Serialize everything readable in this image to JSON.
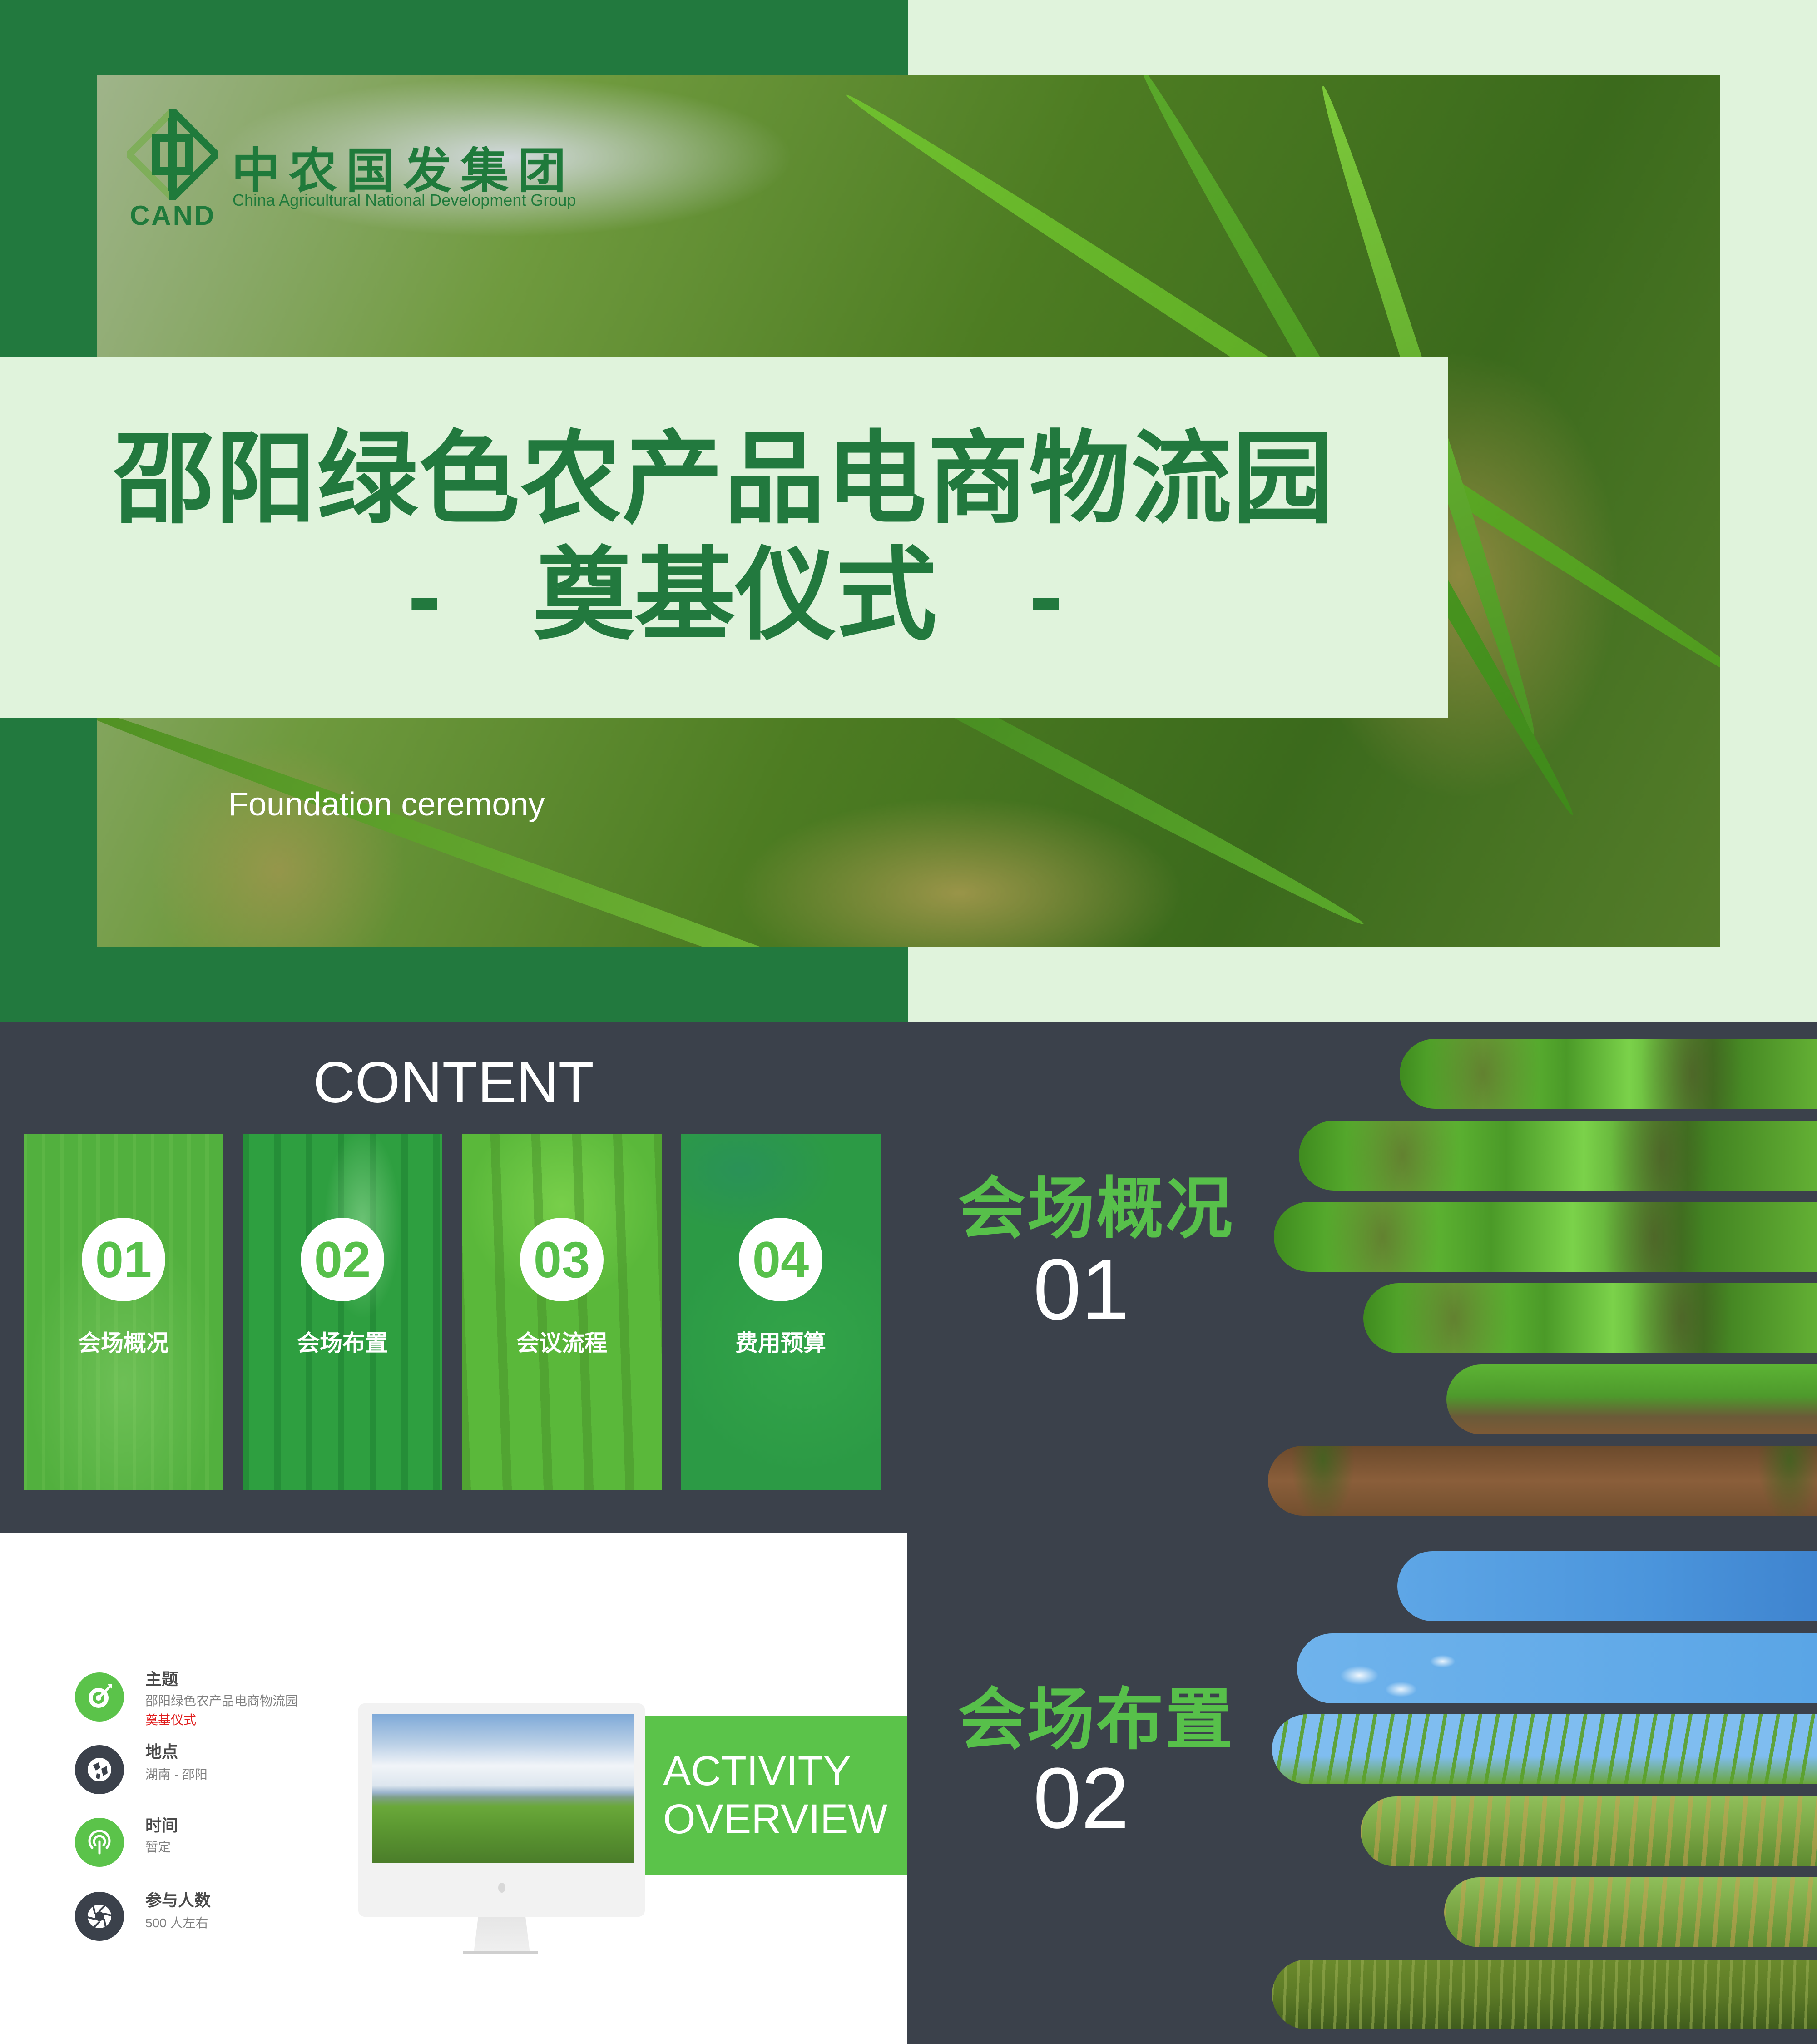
{
  "colors": {
    "dark_green": "#22793e",
    "light_green": "#e0f3dc",
    "accent_green": "#57c04a",
    "slate": "#3b414b",
    "highlight_red": "#e01e1e"
  },
  "cover": {
    "logo": {
      "icon": "cand-diamond-logo-icon",
      "abbr": "CAND",
      "name_cn": "中农国发集团",
      "name_en": "China Agricultural National Development Group"
    },
    "title_line1": "邵阳绿色农产品电商物流园",
    "title_line2": "-  奠基仪式  -",
    "subtitle": "Foundation ceremony"
  },
  "contents": {
    "heading": "CONTENT",
    "items": [
      {
        "num": "01",
        "label": "会场概况"
      },
      {
        "num": "02",
        "label": "会场布置"
      },
      {
        "num": "03",
        "label": "会议流程"
      },
      {
        "num": "04",
        "label": "费用预算"
      }
    ]
  },
  "overview": {
    "title_line1": "ACTIVITY",
    "title_line2": "OVERVIEW",
    "items": [
      {
        "icon": "target-icon",
        "title": "主题",
        "value": "邵阳绿色农产品电商物流园",
        "value_highlight": "奠基仪式"
      },
      {
        "icon": "globe-icon",
        "title": "地点",
        "value": "湖南 - 邵阳"
      },
      {
        "icon": "broadcast-icon",
        "title": "时间",
        "value": "暂定"
      },
      {
        "icon": "aperture-icon",
        "title": "参与人数",
        "value": "500 人左右"
      }
    ]
  },
  "sections": [
    {
      "title": "会场概况",
      "num": "01"
    },
    {
      "title": "会场布置",
      "num": "02"
    }
  ]
}
